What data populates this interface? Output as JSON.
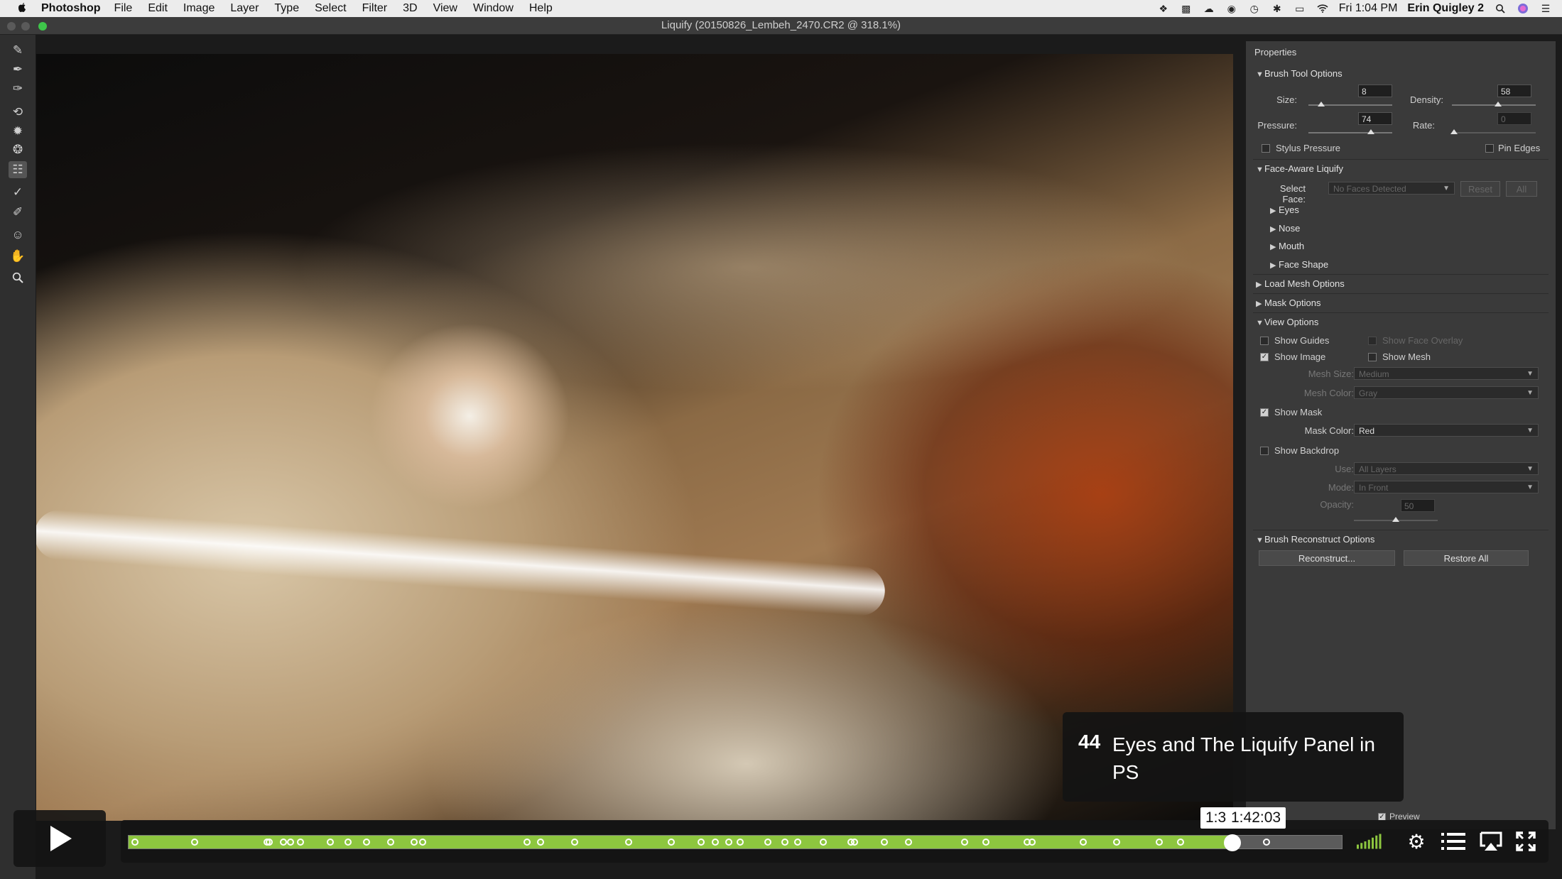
{
  "menubar": {
    "apple": "",
    "app": "Photoshop",
    "items": [
      "File",
      "Edit",
      "Image",
      "Layer",
      "Type",
      "Select",
      "Filter",
      "3D",
      "View",
      "Window",
      "Help"
    ],
    "clock": "Fri 1:04 PM",
    "user": "Erin Quigley 2",
    "status_icons": [
      "dropbox-icon",
      "evernote-icon",
      "creative-cloud-icon",
      "screen-mirror-icon",
      "time-machine-icon",
      "bluetooth-icon",
      "airplay-icon",
      "wifi-icon",
      "spotlight-icon",
      "siri-icon",
      "notification-icon"
    ]
  },
  "window": {
    "title": "Liquify (20150826_Lembeh_2470.CR2 @ 318.1%)"
  },
  "tools": [
    "forward-warp-icon",
    "reconstruct-icon",
    "smooth-icon",
    "twirl-icon",
    "pucker-icon",
    "bloat-icon",
    "face-tool-icon",
    "push-left-icon",
    "freeze-mask-icon",
    "thaw-mask-icon",
    "face-icon",
    "hand-icon",
    "zoom-icon"
  ],
  "panel": {
    "title": "Properties",
    "brush_tool": {
      "header": "Brush Tool Options",
      "size_label": "Size:",
      "size": "8",
      "density_label": "Density:",
      "density": "58",
      "pressure_label": "Pressure:",
      "pressure": "74",
      "rate_label": "Rate:",
      "rate": "0",
      "stylus_label": "Stylus Pressure",
      "pin_label": "Pin Edges"
    },
    "face_aware": {
      "header": "Face-Aware Liquify",
      "select_face_label": "Select Face:",
      "select_face_value": "No Faces Detected",
      "reset": "Reset",
      "all": "All",
      "items": [
        "Eyes",
        "Nose",
        "Mouth",
        "Face Shape"
      ]
    },
    "load_mesh": "Load Mesh Options",
    "mask_options": "Mask Options",
    "view_options": {
      "header": "View Options",
      "show_guides": "Show Guides",
      "show_face_overlay": "Show Face Overlay",
      "show_image": "Show Image",
      "show_mesh": "Show Mesh",
      "mesh_size_label": "Mesh Size:",
      "mesh_size": "Medium",
      "mesh_color_label": "Mesh Color:",
      "mesh_color": "Gray",
      "show_mask": "Show Mask",
      "mask_color_label": "Mask Color:",
      "mask_color": "Red",
      "show_backdrop": "Show Backdrop",
      "use_label": "Use:",
      "use": "All Layers",
      "mode_label": "Mode:",
      "mode": "In Front",
      "opacity_label": "Opacity:",
      "opacity": "50"
    },
    "reconstruct": {
      "header": "Brush Reconstruct Options",
      "reconstruct_btn": "Reconstruct...",
      "restore_btn": "Restore All"
    },
    "preview": "Preview"
  },
  "player": {
    "chapter_number": "44",
    "chapter_title": "Eyes and The Liquify Panel in PS",
    "played_fraction": 0.91,
    "time_partial": "1:3",
    "time_hover": "1:42:03",
    "chapter_markers": [
      0,
      0.05,
      0.11,
      0.112,
      0.124,
      0.13,
      0.138,
      0.163,
      0.178,
      0.193,
      0.213,
      0.233,
      0.24,
      0.327,
      0.338,
      0.367,
      0.412,
      0.447,
      0.472,
      0.484,
      0.495,
      0.505,
      0.528,
      0.542,
      0.553,
      0.574,
      0.597,
      0.6,
      0.625,
      0.645,
      0.692,
      0.71,
      0.744,
      0.748,
      0.791,
      0.819,
      0.854,
      0.872,
      0.944
    ]
  }
}
